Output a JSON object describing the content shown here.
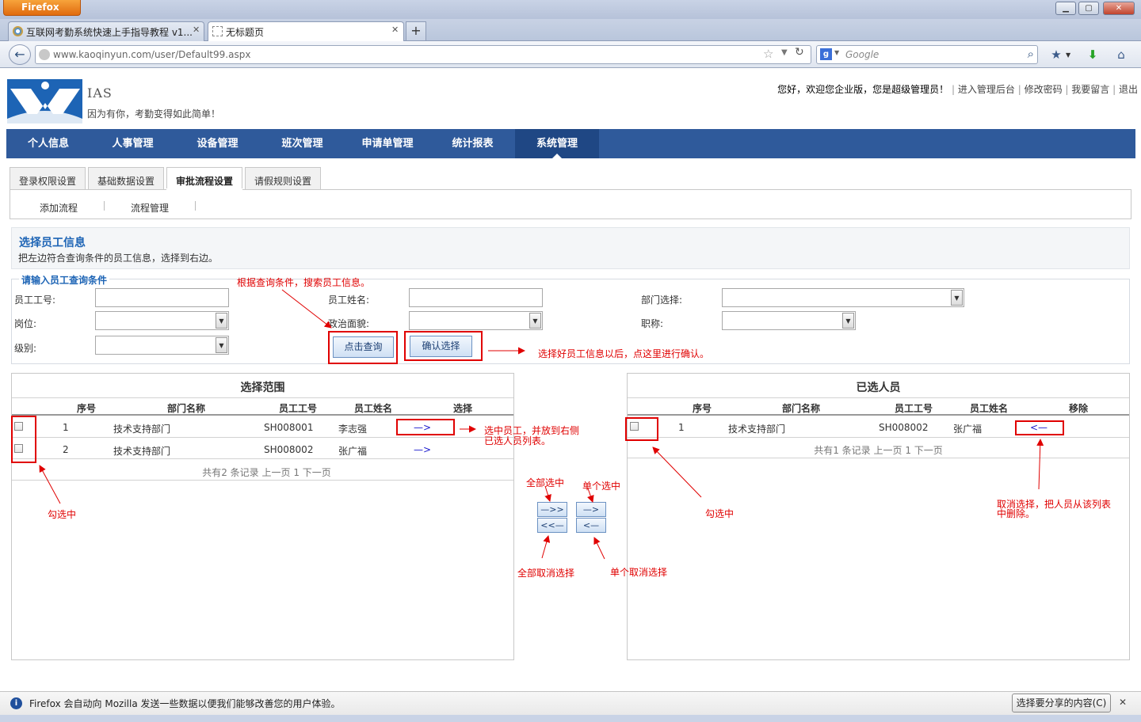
{
  "browser": {
    "app_button": "Firefox",
    "tabs": [
      {
        "label": "互联网考勤系统快速上手指导教程 v1..."
      },
      {
        "label": "无标题页"
      }
    ],
    "new_tab": "+",
    "url": "www.kaoqinyun.com/user/Default99.aspx",
    "search_placeholder": "Google",
    "notification": "Firefox 会自动向 Mozilla 发送一些数据以便我们能够改善您的用户体验。",
    "notification_button": "选择要分享的内容(C)"
  },
  "header": {
    "brand": "IAS",
    "slogan": "因为有你，考勤变得如此简单！",
    "welcome": "您好，欢迎您企业版，您是超级管理员！",
    "links": [
      "进入管理后台",
      "修改密码",
      "我要留言",
      "退出"
    ]
  },
  "main_nav": [
    "个人信息",
    "人事管理",
    "设备管理",
    "班次管理",
    "申请单管理",
    "统计报表",
    "系统管理"
  ],
  "sub_tabs": [
    "登录权限设置",
    "基础数据设置",
    "审批流程设置",
    "请假规则设置"
  ],
  "sub_links": [
    "添加流程",
    "流程管理"
  ],
  "info": {
    "title": "选择员工信息",
    "desc": "把左边符合查询条件的员工信息，选择到右边。"
  },
  "query": {
    "legend": "请输入员工查询条件",
    "labels": {
      "emp_no": "员工工号:",
      "emp_name": "员工姓名:",
      "dept": "部门选择:",
      "position": "岗位:",
      "political": "政治面貌:",
      "title": "职称:",
      "level": "级别:"
    },
    "search_button": "点击查询",
    "confirm_button": "确认选择"
  },
  "annotations": {
    "search_hint": "根据查询条件，搜索员工信息。",
    "confirm_hint": "选择好员工信息以后，点这里进行确认。",
    "select_hint_1": "选中员工，并放到右侧",
    "select_hint_2": "已选人员列表。",
    "check_left": "勾选中",
    "check_right": "勾选中",
    "select_all": "全部选中",
    "select_one": "单个选中",
    "unselect_all": "全部取消选择",
    "unselect_one": "单个取消选择",
    "remove_hint_1": "取消选择，把人员从该列表",
    "remove_hint_2": "中删除。"
  },
  "left_panel": {
    "title": "选择范围",
    "columns": [
      "序号",
      "部门名称",
      "员工工号",
      "员工姓名",
      "选择"
    ],
    "rows": [
      {
        "no": "1",
        "dept": "技术支持部门",
        "emp_no": "SH008001",
        "name": "李志强",
        "action": "—>"
      },
      {
        "no": "2",
        "dept": "技术支持部门",
        "emp_no": "SH008002",
        "name": "张广福",
        "action": "—>"
      }
    ],
    "footer": "共有2 条记录 上一页 1 下一页"
  },
  "right_panel": {
    "title": "已选人员",
    "columns": [
      "序号",
      "部门名称",
      "员工工号",
      "员工姓名",
      "移除"
    ],
    "rows": [
      {
        "no": "1",
        "dept": "技术支持部门",
        "emp_no": "SH008002",
        "name": "张广福",
        "action": "<—"
      }
    ],
    "footer": "共有1 条记录 上一页 1 下一页"
  },
  "move_buttons": {
    "add_all": "—>>",
    "add_one": "—>",
    "remove_all": "<<—",
    "remove_one": "<—"
  },
  "colors": {
    "nav": "#2f5a9b",
    "accent": "#1d64b5",
    "annotation": "#e00000"
  }
}
